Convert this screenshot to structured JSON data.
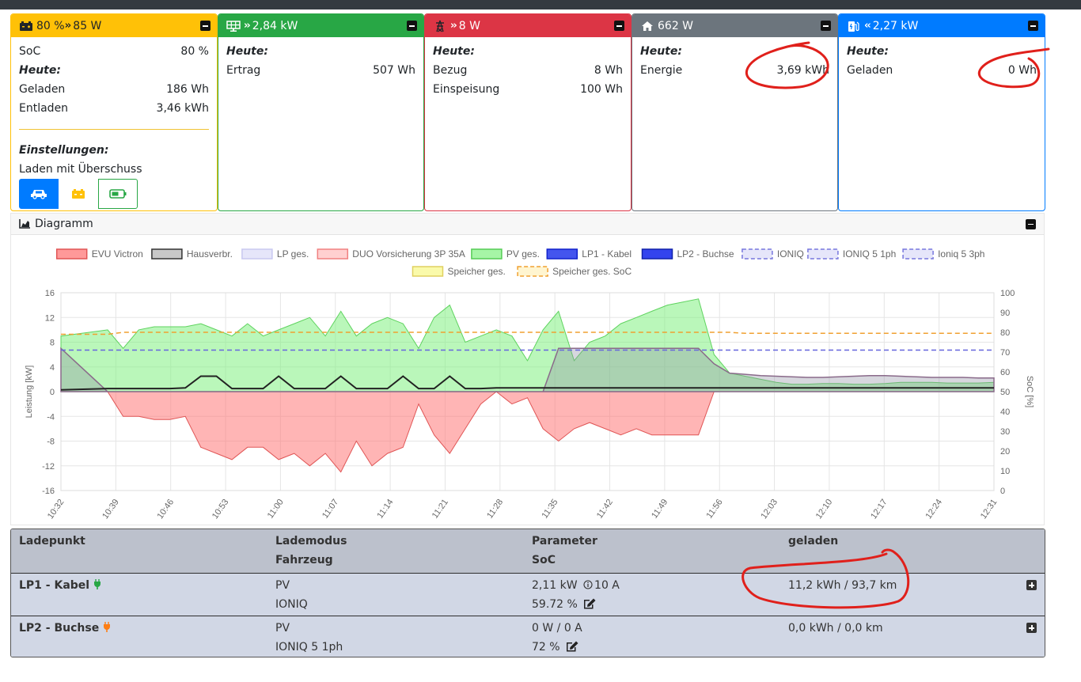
{
  "colors": {
    "battery": "#ffc107",
    "pv": "#28a745",
    "grid": "#dc3545",
    "house": "#6c757d",
    "charge": "#007bff",
    "red_annotation": "#e0201b"
  },
  "cards": {
    "battery": {
      "header": "80 % ",
      "header_power": "85 W",
      "soc_label": "SoC",
      "soc_value": "80 %",
      "today": "Heute:",
      "charged_label": "Geladen",
      "charged_value": "186 Wh",
      "discharged_label": "Entladen",
      "discharged_value": "3,46 kWh",
      "settings_label": "Einstellungen:",
      "mode_label": "Laden mit Überschuss",
      "mode_icons": [
        "car-icon",
        "battery-charge-icon",
        "battery-icon"
      ]
    },
    "pv": {
      "header": "2,84 kW",
      "today": "Heute:",
      "yield_label": "Ertrag",
      "yield_value": "507 Wh"
    },
    "grid": {
      "header": "8 W",
      "today": "Heute:",
      "import_label": "Bezug",
      "import_value": "8 Wh",
      "export_label": "Einspeisung",
      "export_value": "100 Wh"
    },
    "house": {
      "header": "662 W",
      "today": "Heute:",
      "energy_label": "Energie",
      "energy_value": "3,69 kWh"
    },
    "charge": {
      "header": "2,27 kW",
      "today": "Heute:",
      "charged_label": "Geladen",
      "charged_value": "0 Wh"
    }
  },
  "diagram": {
    "title": "Diagramm"
  },
  "chart_data": {
    "type": "area",
    "legend": [
      {
        "name": "EVU Victron",
        "color": "#ff9999",
        "border": "#e05555",
        "dashed": false
      },
      {
        "name": "Hausverbr.",
        "color": "#c8c8c8",
        "border": "#333333",
        "dashed": false
      },
      {
        "name": "LP ges.",
        "color": "#e6e6fa",
        "border": "#c8c8f0",
        "dashed": false
      },
      {
        "name": "DUO Vorsicherung 3P 35A",
        "color": "#ffd0d0",
        "border": "#f08080",
        "dashed": false
      },
      {
        "name": "PV ges.",
        "color": "#a6f5a6",
        "border": "#55cc55",
        "dashed": false
      },
      {
        "name": "LP1 - Kabel",
        "color": "#4455ee",
        "border": "#1122cc",
        "dashed": false
      },
      {
        "name": "LP2 - Buchse",
        "color": "#3344ee",
        "border": "#1122aa",
        "dashed": false
      },
      {
        "name": "IONIQ",
        "color": "#e6e6fa",
        "border": "#7777dd",
        "dashed": true
      },
      {
        "name": "IONIQ 5 1ph",
        "color": "#e6e6fa",
        "border": "#7777dd",
        "dashed": true
      },
      {
        "name": "Ioniq 5 3ph",
        "color": "#e6e6fa",
        "border": "#7777dd",
        "dashed": true
      },
      {
        "name": "Speicher ges.",
        "color": "#fafaaa",
        "border": "#e0d060",
        "dashed": false
      },
      {
        "name": "Speicher ges. SoC",
        "color": "#fff5d0",
        "border": "#f0a030",
        "dashed": true
      }
    ],
    "ylabel": "Leistung [kW]",
    "y2label": "SoC [%]",
    "ylim": [
      -16,
      16
    ],
    "y2lim": [
      0,
      100
    ],
    "yticks": [
      "16",
      "12",
      "8",
      "4",
      "0",
      "-4",
      "-8",
      "-12",
      "-16"
    ],
    "y2ticks": [
      "100",
      "90",
      "80",
      "70",
      "60",
      "50",
      "40",
      "30",
      "20",
      "10",
      "0"
    ],
    "xticks": [
      "10:32",
      "10:39",
      "10:46",
      "10:53",
      "11:00",
      "11:07",
      "11:14",
      "11:21",
      "11:28",
      "11:35",
      "11:42",
      "11:49",
      "11:56",
      "12:03",
      "12:10",
      "12:17",
      "12:24",
      "12:31"
    ],
    "x_minutes": [
      0,
      6,
      8,
      10,
      12,
      14,
      16,
      18,
      20,
      22,
      24,
      26,
      28,
      30,
      32,
      34,
      36,
      38,
      40,
      42,
      44,
      46,
      48,
      50,
      52,
      54,
      56,
      58,
      60,
      62,
      64,
      66,
      68,
      70,
      72,
      74,
      76,
      78,
      80,
      82,
      84,
      86,
      88,
      90,
      92,
      94,
      96,
      98,
      100,
      102,
      104,
      106,
      108,
      110,
      112,
      114,
      116,
      118,
      120
    ],
    "pv": [
      9,
      10,
      7,
      10,
      10.5,
      10.5,
      10.5,
      11,
      10,
      9,
      11,
      9,
      10,
      11,
      12,
      9,
      13,
      9,
      11,
      12,
      11,
      7,
      12,
      14,
      8,
      9,
      10,
      9,
      5,
      10,
      13,
      5,
      8,
      9,
      11,
      12,
      13,
      14,
      14.5,
      15,
      6,
      3,
      2.5,
      2,
      1.5,
      1.2,
      1.2,
      1.3,
      1.3,
      1.2,
      1.2,
      1.3,
      1.5,
      1.5,
      1.5,
      1.4,
      1.4,
      1.4,
      1.5
    ],
    "grid": [
      0,
      0,
      -4,
      -4,
      -4.5,
      -4.5,
      -4,
      -9,
      -10,
      -11,
      -9,
      -9,
      -11,
      -10,
      -12,
      -10,
      -13,
      -8,
      -12,
      -10,
      -9,
      -2,
      -7,
      -10,
      -6,
      -2,
      0,
      -2,
      -1,
      -6,
      -8,
      -6,
      -5,
      -6,
      -7,
      -6,
      -7,
      -7,
      -7,
      -7,
      0,
      0,
      0,
      0,
      0,
      0,
      0,
      0,
      0,
      0,
      0,
      0,
      0,
      0,
      0,
      0,
      0,
      0,
      0
    ],
    "house": [
      0.3,
      0.5,
      0.5,
      0.5,
      0.5,
      0.5,
      0.6,
      2.5,
      2.5,
      0.5,
      0.5,
      0.5,
      2.5,
      0.5,
      0.5,
      0.5,
      2.5,
      0.5,
      0.5,
      0.5,
      2.5,
      0.5,
      0.5,
      2.5,
      0.5,
      0.5,
      0.6,
      0.6,
      0.6,
      0.6,
      0.6,
      0.6,
      0.6,
      0.6,
      0.6,
      0.6,
      0.6,
      0.6,
      0.6,
      0.6,
      0.6,
      0.6,
      0.6,
      0.6,
      0.6,
      0.6,
      0.6,
      0.6,
      0.6,
      0.6,
      0.6,
      0.6,
      0.6,
      0.6,
      0.6,
      0.6,
      0.6,
      0.6,
      0.6
    ],
    "lp": [
      7,
      0,
      0,
      0,
      0,
      0,
      0,
      0,
      0,
      0,
      0,
      0,
      0,
      0,
      0,
      0,
      0,
      0,
      0,
      0,
      0,
      0,
      0,
      0,
      0,
      0,
      0,
      0,
      0,
      0,
      7,
      7,
      7,
      7,
      7,
      7,
      7,
      7,
      7,
      7,
      4.5,
      3,
      2.8,
      2.6,
      2.5,
      2.4,
      2.3,
      2.3,
      2.4,
      2.5,
      2.6,
      2.6,
      2.5,
      2.4,
      2.3,
      2.3,
      2.3,
      2.2,
      2.2
    ],
    "soc": [
      79,
      79,
      80,
      80,
      80,
      80,
      80,
      80,
      80,
      80,
      80,
      80,
      80,
      80,
      80,
      80,
      80,
      80,
      80,
      80,
      80,
      80,
      80,
      80,
      80,
      80,
      80,
      80,
      80,
      80,
      80,
      80,
      80,
      80,
      80,
      80,
      80,
      80,
      80,
      80,
      80,
      80,
      79.5,
      79.5,
      79.5,
      79.5,
      79.5,
      79.5,
      79.5,
      79.5,
      79.5,
      79.5,
      79.5,
      79.5,
      79.5,
      79.5,
      79.5,
      79.5,
      79.5
    ],
    "ev_soc": [
      71,
      71,
      71,
      71,
      71,
      71,
      71,
      71,
      71,
      71,
      71,
      71,
      71,
      71,
      71,
      71,
      71,
      71,
      71,
      71,
      71,
      71,
      71,
      71,
      71,
      71,
      71,
      71,
      71,
      71,
      71,
      71,
      71,
      71,
      71,
      71,
      71,
      71,
      71,
      71,
      71,
      71,
      71,
      71,
      71,
      71,
      71,
      71,
      71,
      71,
      71,
      71,
      71,
      71,
      71,
      71,
      71,
      71,
      71
    ],
    "grid_on": true,
    "legend_placement": "top"
  },
  "table": {
    "headers": {
      "col1": "Ladepunkt",
      "col2_line1": "Lademodus",
      "col2_line2": "Fahrzeug",
      "col3_line1": "Parameter",
      "col3_line2": "SoC",
      "col4": "geladen"
    },
    "rows": [
      {
        "name": "LP1 - Kabel",
        "mode": "PV",
        "vehicle": "IONIQ",
        "param": "2,11 kW",
        "amps": "10 A",
        "soc": "59.72 %",
        "charged": "11,2 kWh / 93,7 km",
        "plug_color": "#28a745"
      },
      {
        "name": "LP2 - Buchse",
        "mode": "PV",
        "vehicle": "IONIQ 5 1ph",
        "param": "0 W / 0 A",
        "amps": "",
        "soc": "72 %",
        "charged": "0,0 kWh / 0,0 km",
        "plug_color": "#fd7e14"
      }
    ]
  }
}
